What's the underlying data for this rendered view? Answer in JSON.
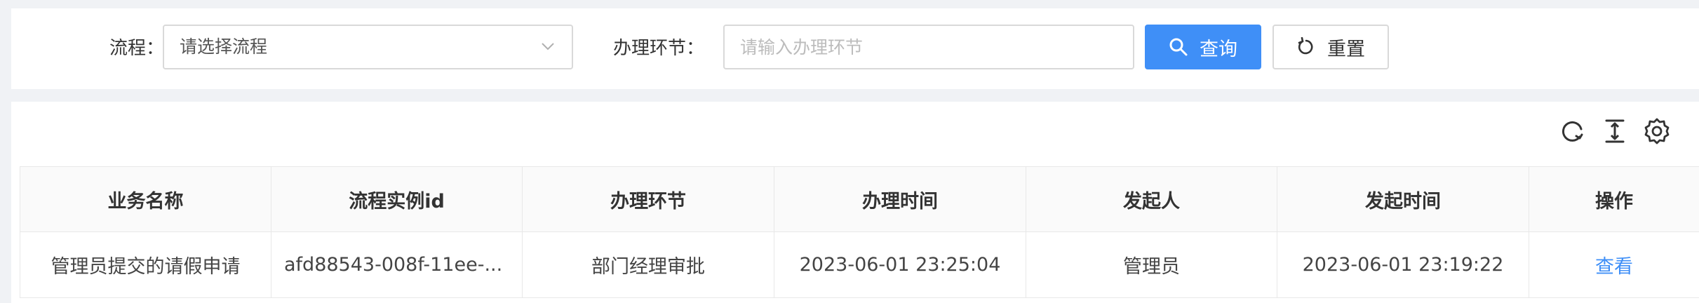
{
  "search": {
    "process_label": "流程：",
    "process_value": "请选择流程",
    "step_label": "办理环节：",
    "step_placeholder": "请输入办理环节",
    "query_label": "查询",
    "reset_label": "重置"
  },
  "toolbar": {
    "icons": [
      "refresh-icon",
      "density-icon",
      "settings-icon"
    ]
  },
  "table": {
    "columns": [
      "业务名称",
      "流程实例id",
      "办理环节",
      "办理时间",
      "发起人",
      "发起时间",
      "操作"
    ],
    "rows": [
      {
        "business_name": "管理员提交的请假申请",
        "instance_id": "afd88543-008f-11ee-...",
        "step": "部门经理审批",
        "handle_time": "2023-06-01 23:25:04",
        "initiator": "管理员",
        "start_time": "2023-06-01 23:19:22",
        "action": "查看"
      }
    ]
  },
  "colors": {
    "primary": "#3f8ff7",
    "background": "#f0f2f5",
    "border": "#d9d9d9"
  }
}
